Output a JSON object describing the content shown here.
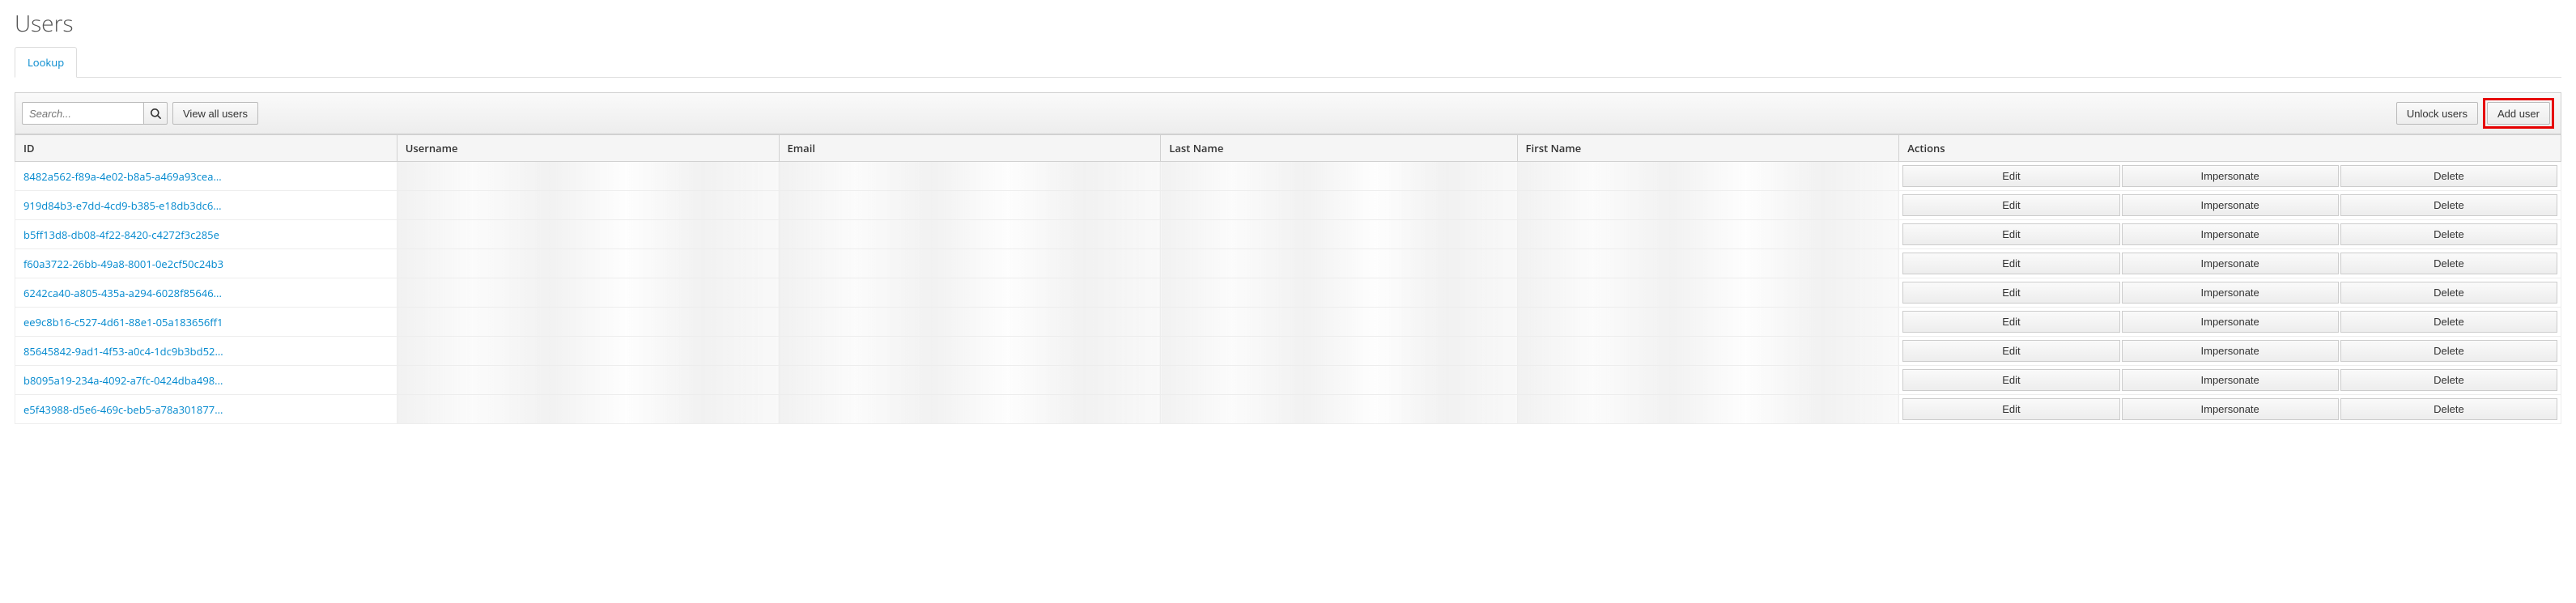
{
  "page": {
    "title": "Users"
  },
  "tabs": {
    "lookup": "Lookup"
  },
  "toolbar": {
    "search_placeholder": "Search...",
    "view_all_label": "View all users",
    "unlock_label": "Unlock users",
    "add_user_label": "Add user"
  },
  "columns": {
    "id": "ID",
    "username": "Username",
    "email": "Email",
    "last_name": "Last Name",
    "first_name": "First Name",
    "actions": "Actions"
  },
  "actions": {
    "edit": "Edit",
    "impersonate": "Impersonate",
    "delete": "Delete"
  },
  "rows": [
    {
      "id": "8482a562-f89a-4e02-b8a5-a469a93cea..."
    },
    {
      "id": "919d84b3-e7dd-4cd9-b385-e18db3dc6..."
    },
    {
      "id": "b5ff13d8-db08-4f22-8420-c4272f3c285e"
    },
    {
      "id": "f60a3722-26bb-49a8-8001-0e2cf50c24b3"
    },
    {
      "id": "6242ca40-a805-435a-a294-6028f85646..."
    },
    {
      "id": "ee9c8b16-c527-4d61-88e1-05a183656ff1"
    },
    {
      "id": "85645842-9ad1-4f53-a0c4-1dc9b3bd52..."
    },
    {
      "id": "b8095a19-234a-4092-a7fc-0424dba498..."
    },
    {
      "id": "e5f43988-d5e6-469c-beb5-a78a301877..."
    }
  ]
}
